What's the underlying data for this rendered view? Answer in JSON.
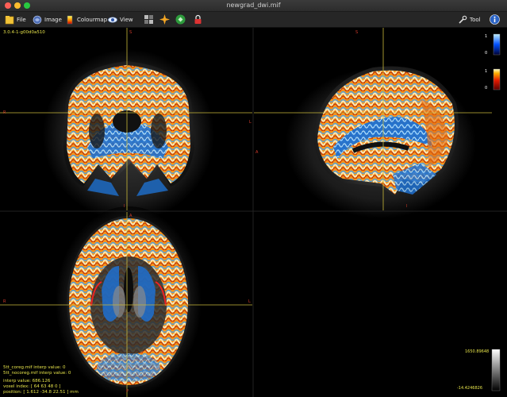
{
  "window": {
    "title": "newgrad_dwi.mif"
  },
  "toolbar": {
    "file_label": "File",
    "image_label": "Image",
    "colourmap_label": "Colourmap",
    "view_label": "View",
    "tool_label": "Tool"
  },
  "icons": {
    "file": "file-icon",
    "image": "image-icon",
    "colourmap": "colourmap-icon",
    "view": "view-eye-icon",
    "layout": "layout-grid-icon",
    "crosshair": "crosshair-icon",
    "reset": "reset-view-icon",
    "lock": "lock-icon",
    "tool": "tool-icon",
    "info": "info-icon"
  },
  "overlay": {
    "version": "3.0.4-1-g00d0a510",
    "file1": "5tt_coreg.mif interp value: 0",
    "file2": "5tt_nocoreg.mif interp value: 0",
    "interp_value": "interp value: 686.126",
    "voxel_index": "voxel index: [ 64 63 48 0 ]",
    "position": "position: [ 1.612 -34.8 22.51 ] mm"
  },
  "orientation": {
    "sup": "S",
    "inf": "I",
    "right": "R",
    "left": "L",
    "anterior": "A",
    "posterior": "P"
  },
  "colourbars": {
    "blue_max": "1",
    "blue_min": "0",
    "hot_max": "1",
    "hot_min": "0",
    "gray_max": "1650.89648",
    "gray_min": "-14.4246826"
  },
  "colors": {
    "close": "#fe5f57",
    "minimize": "#febc2e",
    "zoom": "#28c840",
    "crosshair": "#c9b93a",
    "overlay_text": "#e6e34a",
    "orientation_text": "#d43b2c"
  }
}
